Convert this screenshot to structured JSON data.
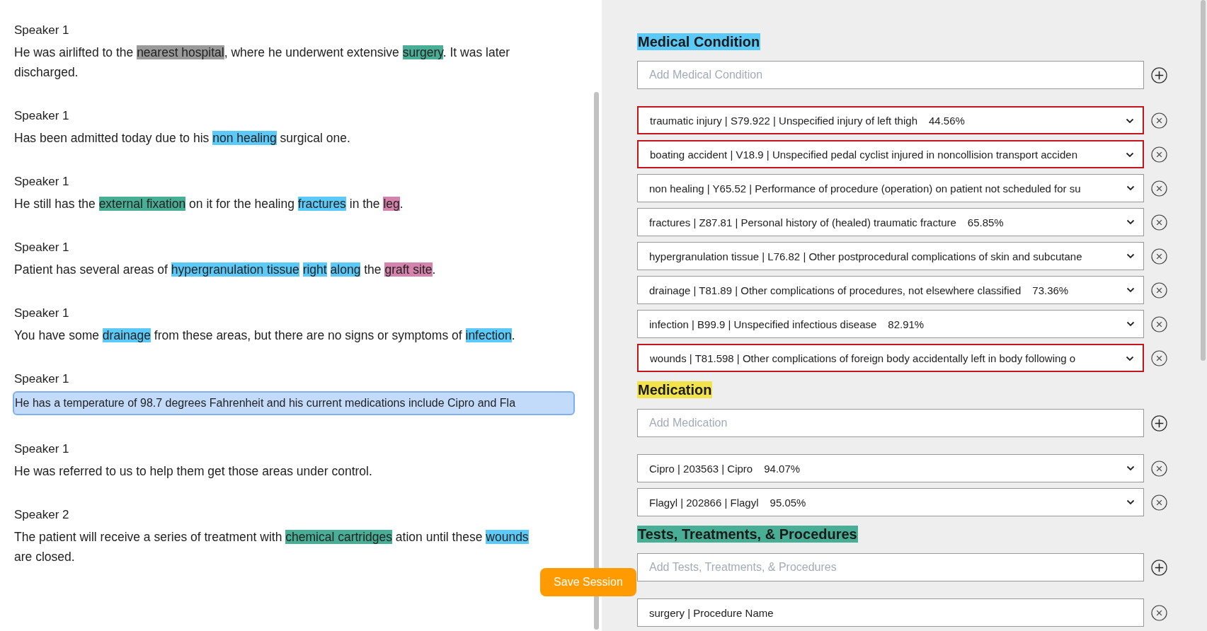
{
  "transcript": [
    {
      "speaker": "Speaker 1",
      "editing": false,
      "segments": [
        {
          "text": "He was airlifted to the "
        },
        {
          "text": "nearest hospital",
          "color": "#9a9a9a"
        },
        {
          "text": ", where he underwent extensive "
        },
        {
          "text": "surgery",
          "color": "#48ae96"
        },
        {
          "text": ". It was later discharged."
        }
      ]
    },
    {
      "speaker": "Speaker 1",
      "editing": false,
      "segments": [
        {
          "text": "Has been admitted today due to his "
        },
        {
          "text": "non healing",
          "color": "#5bcaf9"
        },
        {
          "text": " surgical one."
        }
      ]
    },
    {
      "speaker": "Speaker 1",
      "editing": false,
      "segments": [
        {
          "text": "He still has the "
        },
        {
          "text": "external fixation",
          "color": "#48ae96"
        },
        {
          "text": " on it for the healing "
        },
        {
          "text": "fractures",
          "color": "#5bcaf9"
        },
        {
          "text": " in the "
        },
        {
          "text": "leg",
          "color": "#d583ac"
        },
        {
          "text": "."
        }
      ]
    },
    {
      "speaker": "Speaker 1",
      "editing": false,
      "segments": [
        {
          "text": "Patient has several areas of "
        },
        {
          "text": "hypergranulation tissue",
          "color": "#5bcaf9"
        },
        {
          "text": "right",
          "color": "#5bcaf9"
        },
        {
          "text": "along",
          "color": "#5bcaf9"
        },
        {
          "text": " the "
        },
        {
          "text": "graft site",
          "color": "#d583ac"
        },
        {
          "text": "."
        }
      ]
    },
    {
      "speaker": "Speaker 1",
      "editing": false,
      "segments": [
        {
          "text": "You have some "
        },
        {
          "text": "drainage",
          "color": "#5bcaf9"
        },
        {
          "text": " from these areas, but there are no signs or symptoms of "
        },
        {
          "text": "infection",
          "color": "#5bcaf9"
        },
        {
          "text": "."
        }
      ]
    },
    {
      "speaker": "Speaker 1",
      "editing": true,
      "segments": [
        {
          "text": "He has a temperature of 98.7 degrees Fahrenheit and his current medications include Cipro and Fla"
        }
      ]
    },
    {
      "speaker": "Speaker 1",
      "editing": false,
      "segments": [
        {
          "text": "He was referred to us to help them get those areas under control."
        }
      ]
    },
    {
      "speaker": "Speaker 2",
      "editing": false,
      "segments": [
        {
          "text": "The patient will receive a series of treatment with "
        },
        {
          "text": "chemical cartridges",
          "color": "#48ae96"
        },
        {
          "text": " ation until these "
        },
        {
          "text": "wounds",
          "color": "#5bcaf9"
        },
        {
          "text": " are closed."
        }
      ]
    }
  ],
  "save_button": "Save Session",
  "sections": [
    {
      "title": "Medical Condition",
      "color": "#5bcaf9",
      "placeholder": "Add Medical Condition",
      "items": [
        {
          "kind": "select",
          "flagged": true,
          "text": "traumatic injury | S79.922 | Unspecified injury of left thigh",
          "score": "44.56%"
        },
        {
          "kind": "select",
          "flagged": true,
          "text": "boating accident | V18.9 | Unspecified pedal cyclist injured in noncollision transport acciden"
        },
        {
          "kind": "select",
          "flagged": false,
          "text": "non healing | Y65.52 | Performance of procedure (operation) on patient not scheduled for su"
        },
        {
          "kind": "select",
          "flagged": false,
          "text": "fractures | Z87.81 | Personal history of (healed) traumatic fracture",
          "score": "65.85%"
        },
        {
          "kind": "select",
          "flagged": false,
          "text": "hypergranulation tissue | L76.82 | Other postprocedural complications of skin and subcutane"
        },
        {
          "kind": "select",
          "flagged": false,
          "text": "drainage | T81.89 | Other complications of procedures, not elsewhere classified",
          "score": "73.36%"
        },
        {
          "kind": "select",
          "flagged": false,
          "text": "infection | B99.9 | Unspecified infectious disease",
          "score": "82.91%"
        },
        {
          "kind": "select",
          "flagged": true,
          "text": "wounds | T81.598 | Other complications of foreign body accidentally left in body following o"
        }
      ]
    },
    {
      "title": "Medication",
      "color": "#f2e34a",
      "placeholder": "Add Medication",
      "items": [
        {
          "kind": "select",
          "flagged": false,
          "text": "Cipro | 203563 | Cipro",
          "score": "94.07%"
        },
        {
          "kind": "select",
          "flagged": false,
          "text": "Flagyl | 202866 | Flagyl",
          "score": "95.05%"
        }
      ]
    },
    {
      "title": "Tests, Treatments, & Procedures",
      "color": "#48ae96",
      "placeholder": "Add Tests, Treatments, & Procedures",
      "items": [
        {
          "kind": "text",
          "flagged": false,
          "text": "surgery | Procedure Name"
        }
      ]
    }
  ]
}
